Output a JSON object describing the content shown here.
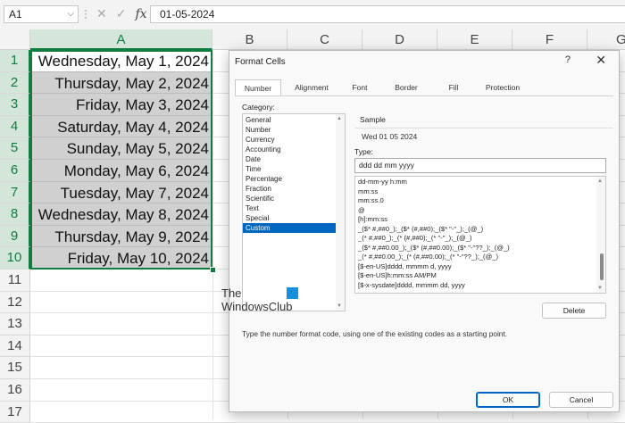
{
  "formula_bar": {
    "name_box": "A1",
    "fx_label": "fx",
    "formula": "01-05-2024"
  },
  "columns": [
    "A",
    "B",
    "C",
    "D",
    "E",
    "F",
    "G"
  ],
  "rows": [
    "1",
    "2",
    "3",
    "4",
    "5",
    "6",
    "7",
    "8",
    "9",
    "10",
    "11",
    "12",
    "13",
    "14",
    "15",
    "16",
    "17"
  ],
  "cells": [
    "Wednesday, May 1, 2024",
    "Thursday, May 2, 2024",
    "Friday, May 3, 2024",
    "Saturday, May 4, 2024",
    "Sunday, May 5, 2024",
    "Monday, May 6, 2024",
    "Tuesday, May 7, 2024",
    "Wednesday, May 8, 2024",
    "Thursday, May 9, 2024",
    "Friday, May 10, 2024"
  ],
  "dialog": {
    "title": "Format Cells",
    "help": "?",
    "close": "✕",
    "tabs": [
      "Number",
      "Alignment",
      "Font",
      "Border",
      "Fill",
      "Protection"
    ],
    "category_label": "Category:",
    "categories": [
      "General",
      "Number",
      "Currency",
      "Accounting",
      "Date",
      "Time",
      "Percentage",
      "Fraction",
      "Scientific",
      "Text",
      "Special",
      "Custom"
    ],
    "selected_category": "Custom",
    "sample_label": "Sample",
    "sample_value": "Wed 01 05 2024",
    "type_label": "Type:",
    "type_value": "ddd dd mm yyyy",
    "formats": [
      "dd-mm-yy h:mm",
      "mm:ss",
      "mm:ss.0",
      "@",
      "[h]:mm:ss",
      "_($* #,##0_);_($* (#,##0);_($* \"-\"_);_(@_)",
      "_(* #,##0_);_(* (#,##0);_(* \"-\"_);_(@_)",
      "_($* #,##0.00_);_($* (#,##0.00);_($* \"-\"??_);_(@_)",
      "_(* #,##0.00_);_(* (#,##0.00);_(* \"-\"??_);_(@_)",
      "[$-en-US]dddd, mmmm d, yyyy",
      "[$-en-US]h:mm:ss AM/PM",
      "[$-x-sysdate]dddd, mmmm dd, yyyy"
    ],
    "delete_label": "Delete",
    "help_text": "Type the number format code, using one of the existing codes as a starting point.",
    "ok_label": "OK",
    "cancel_label": "Cancel"
  },
  "watermark": {
    "line1": "The",
    "line2": "WindowsClub"
  },
  "colors": {
    "excel_green": "#107c41",
    "selection_blue": "#0067c0",
    "cell_highlight": "#d0d0d0"
  }
}
